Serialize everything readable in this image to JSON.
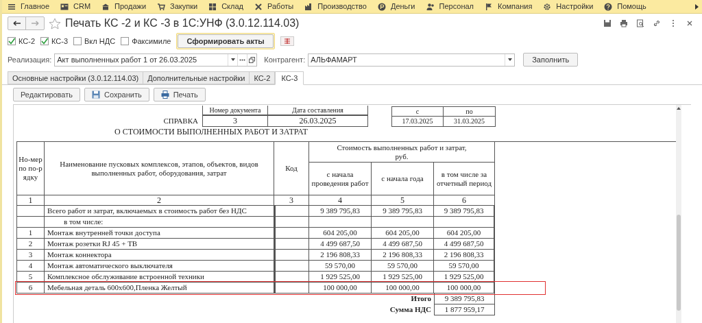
{
  "menu": [
    {
      "label": "Главное"
    },
    {
      "label": "CRM"
    },
    {
      "label": "Продажи"
    },
    {
      "label": "Закупки"
    },
    {
      "label": "Склад"
    },
    {
      "label": "Работы"
    },
    {
      "label": "Производство"
    },
    {
      "label": "Деньги"
    },
    {
      "label": "Персонал"
    },
    {
      "label": "Компания"
    },
    {
      "label": "Настройки"
    },
    {
      "label": "Помощь"
    }
  ],
  "window": {
    "title": "Печать КС -2 и КС -3 в 1С:УНФ (3.0.12.114.03)"
  },
  "options": [
    {
      "label": "КС-2",
      "checked": true
    },
    {
      "label": "КС-3",
      "checked": true
    },
    {
      "label": "Вкл НДС",
      "checked": false
    },
    {
      "label": "Факсимиле",
      "checked": false
    }
  ],
  "generate_button": "Сформировать акты",
  "realization": {
    "label": "Реализация:",
    "value": "Акт выполненных работ 1 от 26.03.2025"
  },
  "counterparty": {
    "label": "Контрагент:",
    "value": "АЛЬФАМАРТ"
  },
  "fill_button": "Заполнить",
  "tabs": [
    {
      "label": "Основные настройки (3.0.12.114.03)",
      "selected": false
    },
    {
      "label": "Дополнительные настройки",
      "selected": false
    },
    {
      "label": "КС-2",
      "selected": false
    },
    {
      "label": "КС-3",
      "selected": true
    }
  ],
  "toolbar": [
    "Редактировать",
    "Сохранить",
    "Печать"
  ],
  "document": {
    "number_label": "Номер документа",
    "date_label": "Дата составления",
    "number": "3",
    "date": "26.03.2025",
    "period_from_label": "с",
    "period_to_label": "по",
    "period_from": "17.03.2025",
    "period_to": "31.03.2025",
    "title": "СПРАВКА",
    "subtitle": "О СТОИМОСТИ ВЫПОЛНЕННЫХ РАБОТ И ЗАТРАТ",
    "columns": {
      "number": "Но-мер по по-рядку",
      "name": "Наименование пусковых комплексов, этапов, объектов, видов выполненных работ, оборудования, затрат",
      "code": "Код",
      "cost_group": "Стоимость выполненных работ и затрат, руб.",
      "from_start": "с начала проведения работ",
      "from_year": "с начала  года",
      "period": "в том числе за отчетный период"
    },
    "column_numbers": [
      "1",
      "2",
      "3",
      "4",
      "5",
      "6"
    ],
    "rows": [
      {
        "kind": "total",
        "number": "",
        "name": "Всего работ и затрат, включаемых в стоимость работ без НДС",
        "from_start": "9 389 795,83",
        "from_year": "9 389 795,83",
        "period": "9 389 795,83",
        "highlighted": false
      },
      {
        "kind": "subheader",
        "number": "",
        "name": "в том числе:",
        "from_start": "",
        "from_year": "",
        "period": "",
        "highlighted": false
      },
      {
        "kind": "item",
        "number": "1",
        "name": "Монтаж внутренней точки доступа",
        "from_start": "604 205,00",
        "from_year": "604 205,00",
        "period": "604 205,00",
        "highlighted": false
      },
      {
        "kind": "item",
        "number": "2",
        "name": "Монтаж розетки RJ 45 + ТВ",
        "from_start": "4 499 687,50",
        "from_year": "4 499 687,50",
        "period": "4 499 687,50",
        "highlighted": false
      },
      {
        "kind": "item",
        "number": "3",
        "name": "Монтаж коннектора",
        "from_start": "2 196 808,33",
        "from_year": "2 196 808,33",
        "period": "2 196 808,33",
        "highlighted": false
      },
      {
        "kind": "item",
        "number": "4",
        "name": "Монтаж автоматического выключателя",
        "from_start": "59 570,00",
        "from_year": "59 570,00",
        "period": "59 570,00",
        "highlighted": false
      },
      {
        "kind": "item",
        "number": "5",
        "name": "Комплексное обслуживание встроенной техники",
        "from_start": "1 929 525,00",
        "from_year": "1 929 525,00",
        "period": "1 929 525,00",
        "highlighted": false
      },
      {
        "kind": "item",
        "number": "6",
        "name": "Мебельная деталь 600х600,Пленка Желтый",
        "from_start": "100 000,00",
        "from_year": "100 000,00",
        "period": "100 000,00",
        "highlighted": true
      }
    ],
    "totals": [
      {
        "label": "Итого",
        "value": "9 389 795,83"
      },
      {
        "label": "Сумма НДС",
        "value": "1 877 959,17"
      }
    ]
  }
}
